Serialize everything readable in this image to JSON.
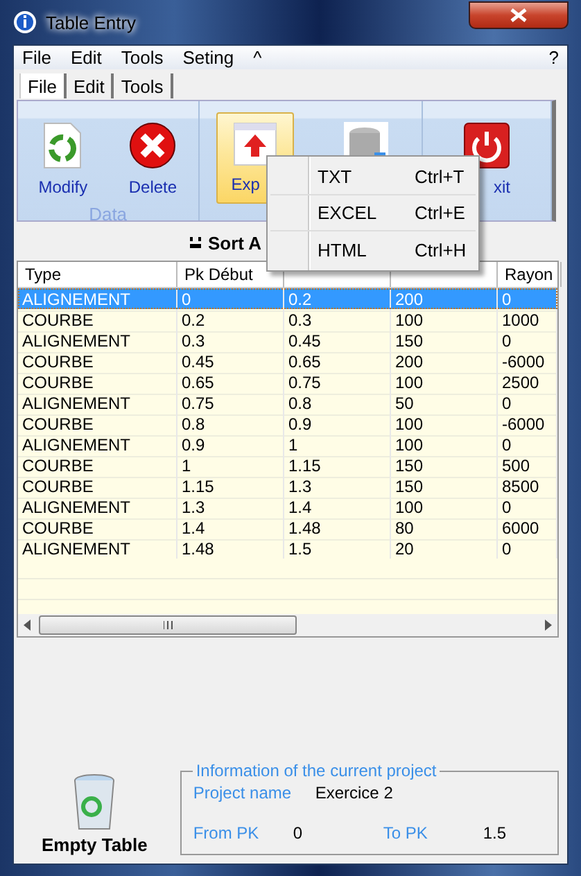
{
  "window": {
    "title": "Table Entry"
  },
  "menu_bar": {
    "items": [
      "File",
      "Edit",
      "Tools",
      "Seting",
      "^"
    ],
    "help": "?"
  },
  "tabs": [
    {
      "label": "File",
      "selected": true
    },
    {
      "label": "Edit",
      "selected": false
    },
    {
      "label": "Tools",
      "selected": false
    }
  ],
  "ribbon": {
    "groups": [
      {
        "label": "Data",
        "buttons": [
          {
            "kind": "modify",
            "label": "Modify",
            "selected": false
          },
          {
            "kind": "delete",
            "label": "Delete",
            "selected": false
          }
        ]
      },
      {
        "buttons": [
          {
            "kind": "export",
            "label": "Exp",
            "selected": true
          },
          {
            "kind": "database",
            "selected": false
          }
        ]
      },
      {
        "buttons": [
          {
            "kind": "exit",
            "label": "xit",
            "selected": false
          }
        ]
      }
    ]
  },
  "dropdown_menu": [
    {
      "label": "TXT",
      "shortcut": "Ctrl+T"
    },
    {
      "label": "EXCEL",
      "shortcut": "Ctrl+E"
    },
    {
      "label": "HTML",
      "shortcut": "Ctrl+H"
    }
  ],
  "sort_label": "Sort A",
  "table": {
    "columns": [
      "Type",
      "Pk Début",
      null,
      null,
      "Rayon"
    ],
    "rows": [
      {
        "selected": true,
        "cells": [
          "ALIGNEMENT",
          "0",
          "0.2",
          "200",
          "0"
        ]
      },
      {
        "selected": false,
        "cells": [
          "COURBE",
          "0.2",
          "0.3",
          "100",
          "1000"
        ]
      },
      {
        "selected": false,
        "cells": [
          "ALIGNEMENT",
          "0.3",
          "0.45",
          "150",
          "0"
        ]
      },
      {
        "selected": false,
        "cells": [
          "COURBE",
          "0.45",
          "0.65",
          "200",
          "-6000"
        ]
      },
      {
        "selected": false,
        "cells": [
          "COURBE",
          "0.65",
          "0.75",
          "100",
          "2500"
        ]
      },
      {
        "selected": false,
        "cells": [
          "ALIGNEMENT",
          "0.75",
          "0.8",
          "50",
          "0"
        ]
      },
      {
        "selected": false,
        "cells": [
          "COURBE",
          "0.8",
          "0.9",
          "100",
          "-6000"
        ]
      },
      {
        "selected": false,
        "cells": [
          "ALIGNEMENT",
          "0.9",
          "1",
          "100",
          "0"
        ]
      },
      {
        "selected": false,
        "cells": [
          "COURBE",
          "1",
          "1.15",
          "150",
          "500"
        ]
      },
      {
        "selected": false,
        "cells": [
          "COURBE",
          "1.15",
          "1.3",
          "150",
          "8500"
        ]
      },
      {
        "selected": false,
        "cells": [
          "ALIGNEMENT",
          "1.3",
          "1.4",
          "100",
          "0"
        ]
      },
      {
        "selected": false,
        "cells": [
          "COURBE",
          "1.4",
          "1.48",
          "80",
          "6000"
        ]
      },
      {
        "selected": false,
        "cells": [
          "ALIGNEMENT",
          "1.48",
          "1.5",
          "20",
          "0"
        ]
      }
    ]
  },
  "empty_table_button": {
    "label": "Empty Table"
  },
  "project_info": {
    "title": "Information of the current project",
    "project_name_label": "Project name",
    "project_name": "Exercice 2",
    "from_pk_label": "From PK",
    "from_pk": "0",
    "to_pk_label": "To PK",
    "to_pk": "1.5"
  }
}
